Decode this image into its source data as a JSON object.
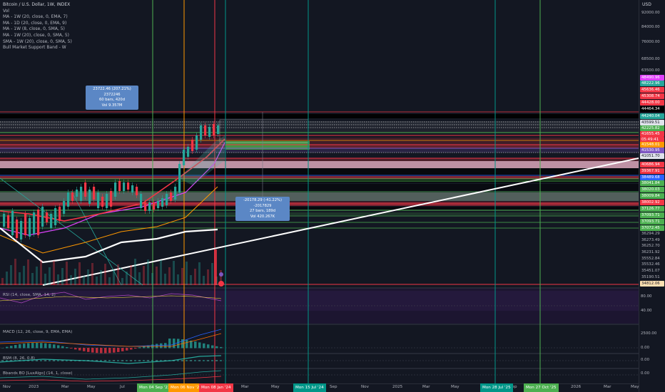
{
  "symbol": {
    "title": "Bitcoin / U.S. Dollar, 1W, INDEX",
    "vol_label": "Vol",
    "indicators": [
      "MA - 1W (20, close, 0, EMA, 7)",
      "MA - 1D (20, close, 0, EMA, 9)",
      "MA - 1W (8, close, 0, SMA, 5)",
      "MA - 1W (20), close, 0, SMA, 5)",
      "SMA - 1W (20), close, 0, SMA, 5)",
      "Bull Market Support Band - W"
    ]
  },
  "currency": "USD",
  "price_axis": [
    {
      "text": "92000.00",
      "style": "plain"
    },
    {
      "text": "84000.00",
      "style": "plain"
    },
    {
      "text": "76000.00",
      "style": "plain"
    },
    {
      "text": "68500.00",
      "style": "plain"
    },
    {
      "text": "63500.00",
      "style": "plain"
    },
    {
      "text": "48490.96",
      "style": "#e040fb"
    },
    {
      "text": "48222.96",
      "style": "#26a69a"
    },
    {
      "text": "45636.46",
      "style": "#f23645"
    },
    {
      "text": "45308.74",
      "style": "#f23645"
    },
    {
      "text": "44428.00",
      "style": "#f23645"
    },
    {
      "text": "44464.34",
      "style": "#000000"
    },
    {
      "text": "44240.04",
      "style": "#26a69a"
    },
    {
      "text": "43599.51",
      "style": "#ffffff-dark"
    },
    {
      "text": "42225.82",
      "style": "#4caf50"
    },
    {
      "text": "41655.45",
      "style": "#f23645"
    },
    {
      "text": "05:49:41",
      "style": "#f23645"
    },
    {
      "text": "41548.01",
      "style": "#ff9800"
    },
    {
      "text": "41530.95",
      "style": "#7e57c2"
    },
    {
      "text": "41051.70",
      "style": "#ffffff-dark"
    },
    {
      "text": "40686.94",
      "style": "#f23645"
    },
    {
      "text": "39367.91",
      "style": "#f23645"
    },
    {
      "text": "38489.68",
      "style": "#2962ff"
    },
    {
      "text": "38041.84",
      "style": "#4caf50"
    },
    {
      "text": "38020.03",
      "style": "#4caf50"
    },
    {
      "text": "38009.84",
      "style": "#4caf50"
    },
    {
      "text": "38002.92",
      "style": "#f23645"
    },
    {
      "text": "37126.77",
      "style": "#4caf50"
    },
    {
      "text": "37093.71",
      "style": "#4caf50"
    },
    {
      "text": "37093.71",
      "style": "#4caf50"
    },
    {
      "text": "37072.45",
      "style": "#4caf50"
    },
    {
      "text": "36294.29",
      "style": "plain"
    },
    {
      "text": "36273.49",
      "style": "plain"
    },
    {
      "text": "36252.70",
      "style": "plain"
    },
    {
      "text": "36231.92",
      "style": "plain"
    },
    {
      "text": "35552.84",
      "style": "plain"
    },
    {
      "text": "35532.46",
      "style": "plain"
    },
    {
      "text": "35451.07",
      "style": "plain"
    },
    {
      "text": "35190.51",
      "style": "plain"
    },
    {
      "text": "34812.06",
      "style": "#ffe0b2"
    }
  ],
  "measure_top": {
    "line1": "23722.46 (207.21%) 2372246",
    "line2": "60 bars, 420d",
    "line3": "Vol 9.357M"
  },
  "measure_bottom": {
    "line1": "-20178.29 (-41.22%) -2017829",
    "line2": "27 bars, 189d",
    "line3": "Vol 420.267K"
  },
  "rsi": {
    "title": "RSI (14, close, SMA, 14, 2)",
    "levels": [
      "80.00",
      "40.00"
    ]
  },
  "macd": {
    "title": "MACD (12, 26, close, 9, EMA, EMA)",
    "levels": [
      "2500.00",
      "0.00"
    ]
  },
  "bsm": {
    "title": "BSM (8, 26, 0.8)",
    "levels": [
      "0.00"
    ]
  },
  "bbands": {
    "title": "Bbands BO [LuxAlgo] (14, 1, close)",
    "levels": [
      "0.00"
    ]
  },
  "time_axis": [
    {
      "text": "Nov"
    },
    {
      "text": "2023"
    },
    {
      "text": "Mar"
    },
    {
      "text": "May"
    },
    {
      "text": "Jul"
    },
    {
      "text": "Mar"
    },
    {
      "text": "May"
    },
    {
      "text": "Sep"
    },
    {
      "text": "Nov"
    },
    {
      "text": "2025"
    },
    {
      "text": "Mar"
    },
    {
      "text": "May"
    },
    {
      "text": "Sep"
    },
    {
      "text": "Nov"
    },
    {
      "text": "2026"
    },
    {
      "text": "Mar"
    },
    {
      "text": "May"
    }
  ],
  "time_badges": [
    {
      "text": "Mon 04 Sep '23",
      "color": "#4caf50"
    },
    {
      "text": "Mon 06 Nov '23",
      "color": "#ff9800"
    },
    {
      "text": "Mon 08 Jan '24",
      "color": "#f23645"
    },
    {
      "text": "Mon 15 Jul '24",
      "color": "#009688"
    },
    {
      "text": "Mon 28 Jul '25",
      "color": "#009688"
    },
    {
      "text": "Mon 27 Oct '25",
      "color": "#4caf50"
    }
  ]
}
